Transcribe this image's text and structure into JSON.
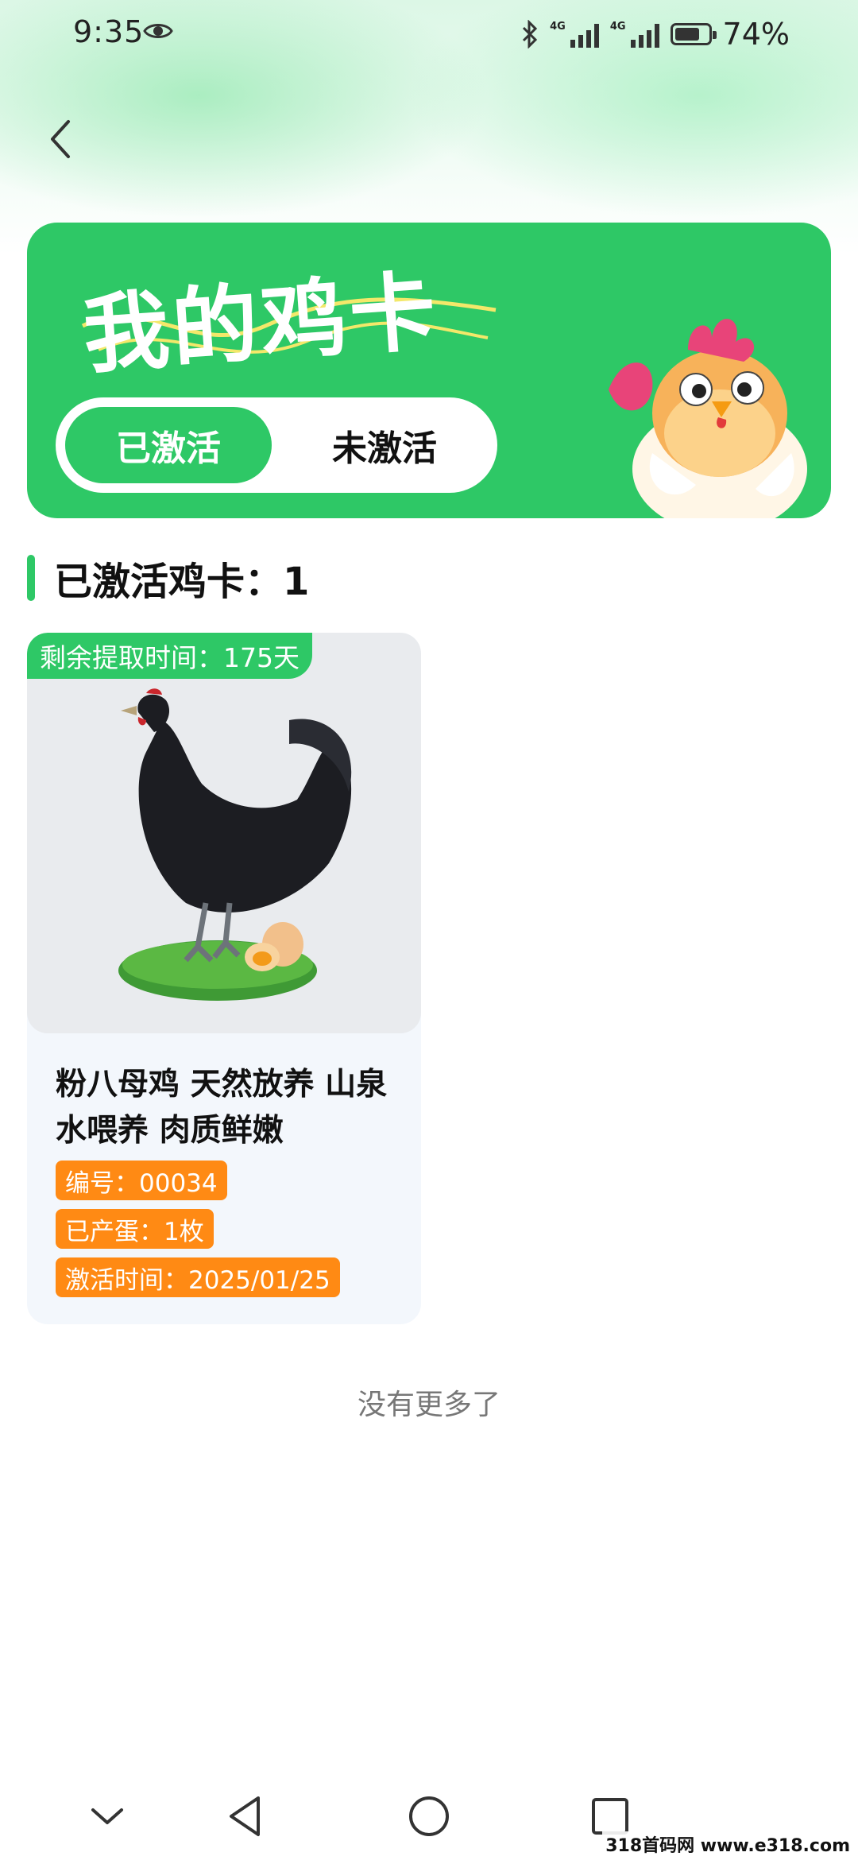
{
  "status_bar": {
    "time": "9:35",
    "network_1": "4G",
    "network_2": "4G",
    "battery_percent": "74%",
    "battery_level": 0.74
  },
  "header": {
    "banner_title": "我的鸡卡",
    "tabs": [
      {
        "label": "已激活",
        "active": true
      },
      {
        "label": "未激活",
        "active": false
      }
    ]
  },
  "section": {
    "title": "已激活鸡卡：1"
  },
  "cards": [
    {
      "remaining": "剩余提取时间：175天",
      "title": "粉八母鸡 天然放养 山泉水喂养 肉质鲜嫩",
      "serial": "编号：00034",
      "eggs": "已产蛋：1枚",
      "activated": "激活时间：2025/01/25"
    }
  ],
  "footer": {
    "no_more": "没有更多了"
  },
  "watermark": "318首码网 www.e318.com",
  "colors": {
    "accent_green": "#2ec866",
    "tag_orange": "#ff8a14"
  }
}
